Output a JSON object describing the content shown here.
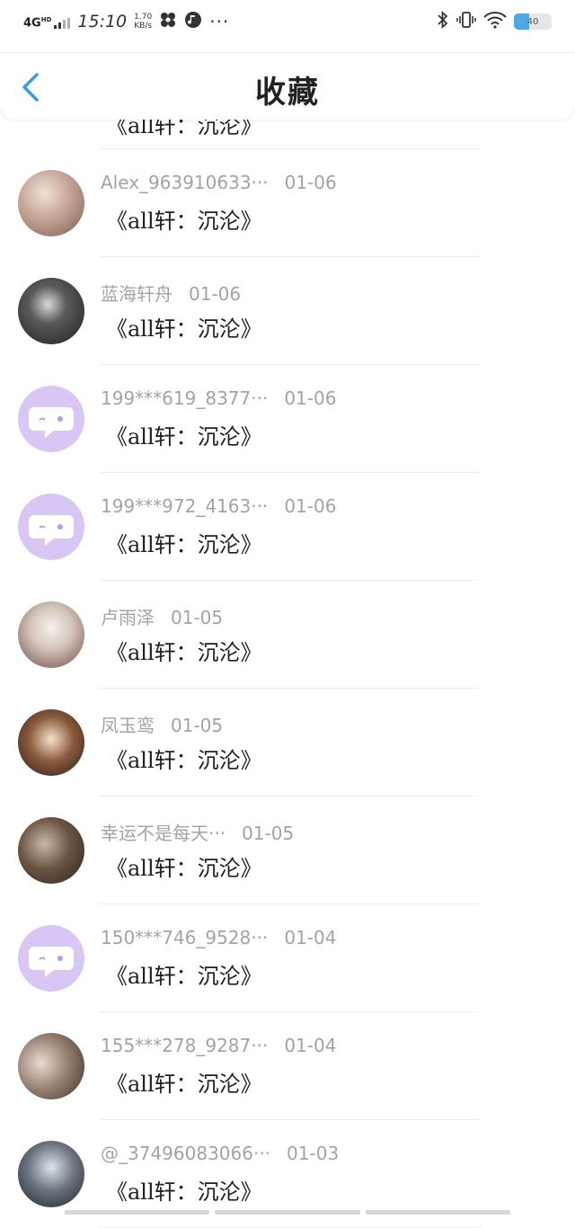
{
  "status_bar": {
    "network": "4G",
    "network_sup": "HD",
    "time": "15:10",
    "speed_value": "1.70",
    "speed_unit": "KB/s",
    "dots": "···",
    "battery": "40",
    "battery_level": 0.4
  },
  "header": {
    "title": "收藏",
    "back_icon": "chevron-left-icon"
  },
  "partial_item": {
    "fav_title": "《all轩：沉沦》"
  },
  "items": [
    {
      "name": "Alex_963910633···",
      "date": "01-06",
      "fav_title": "《all轩：沉沦》",
      "avatar": "photo"
    },
    {
      "name": "蓝海轩舟",
      "date": "01-06",
      "fav_title": "《all轩：沉沦》",
      "avatar": "photo"
    },
    {
      "name": "199***619_8377···",
      "date": "01-06",
      "fav_title": "《all轩：沉沦》",
      "avatar": "default"
    },
    {
      "name": "199***972_4163···",
      "date": "01-06",
      "fav_title": "《all轩：沉沦》",
      "avatar": "default"
    },
    {
      "name": "卢雨泽",
      "date": "01-05",
      "fav_title": "《all轩：沉沦》",
      "avatar": "photo"
    },
    {
      "name": "凤玉鸾",
      "date": "01-05",
      "fav_title": "《all轩：沉沦》",
      "avatar": "photo"
    },
    {
      "name": "幸运不是每天···",
      "date": "01-05",
      "fav_title": "《all轩：沉沦》",
      "avatar": "photo"
    },
    {
      "name": "150***746_9528···",
      "date": "01-04",
      "fav_title": "《all轩：沉沦》",
      "avatar": "default"
    },
    {
      "name": "155***278_9287···",
      "date": "01-04",
      "fav_title": "《all轩：沉沦》",
      "avatar": "photo"
    },
    {
      "name": "@_37496083066···",
      "date": "01-03",
      "fav_title": "《all轩：沉沦》",
      "avatar": "photo"
    }
  ],
  "colors": {
    "accent": "#3a9be0",
    "default_avatar_bg": "#d8c6f5",
    "default_avatar_icon": "#b79af0"
  }
}
